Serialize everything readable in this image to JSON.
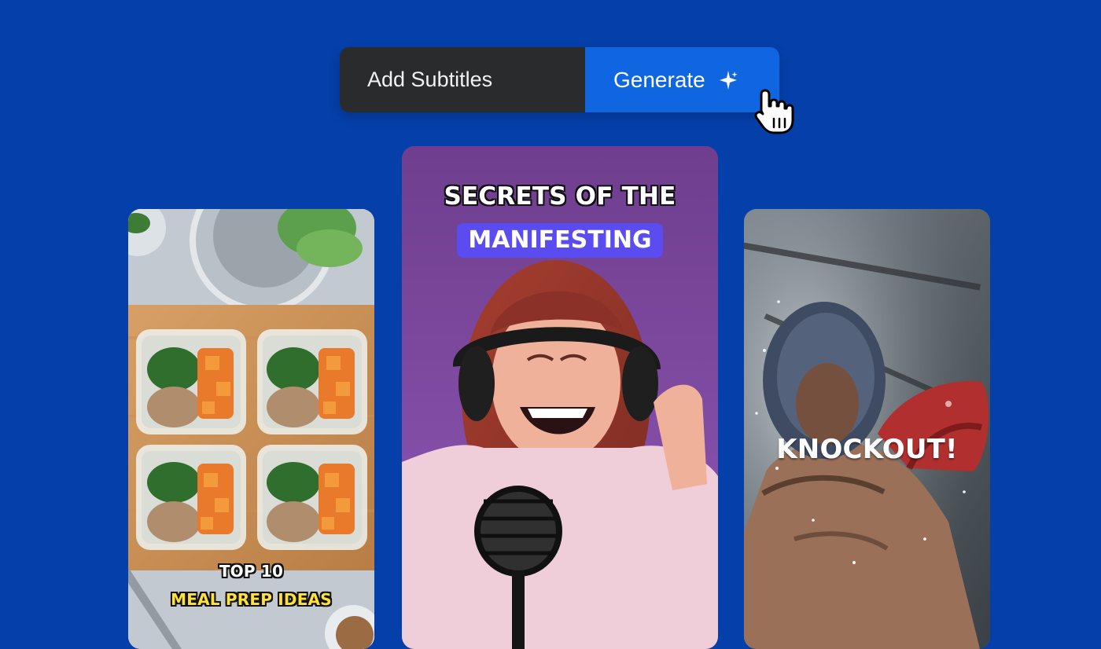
{
  "toolbar": {
    "input_label": "Add Subtitles",
    "generate_label": "Generate"
  },
  "cards": {
    "food": {
      "caption_line1": "TOP 10",
      "caption_line2": "MEAL PREP IDEAS"
    },
    "podcast": {
      "caption_line1": "SECRETS OF THE",
      "caption_line2": "MANIFESTING"
    },
    "boxing": {
      "caption": "KNOCKOUT!"
    }
  },
  "colors": {
    "background": "#053fa9",
    "input_bg": "#2a2b2d",
    "button_bg": "#0f66e0",
    "highlight_bg": "#5a4cf0",
    "food_caption_yellow": "#ffe13c"
  },
  "icons": {
    "generate": "sparkle-icon",
    "cursor": "hand-pointer-icon"
  }
}
